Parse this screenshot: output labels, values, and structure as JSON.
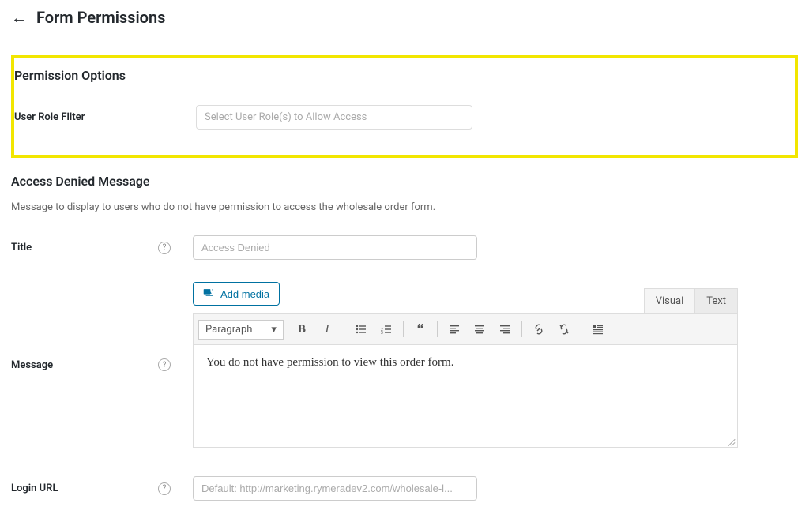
{
  "header": {
    "back_icon": "←",
    "title": "Form Permissions"
  },
  "permission_options": {
    "section_title": "Permission Options",
    "user_role_filter": {
      "label": "User Role Filter",
      "placeholder": "Select User Role(s) to Allow Access"
    }
  },
  "access_denied": {
    "section_title": "Access Denied Message",
    "description": "Message to display to users who do not have permission to access the wholesale order form.",
    "title": {
      "label": "Title",
      "placeholder": "Access Denied"
    },
    "message": {
      "label": "Message",
      "add_media_label": "Add media",
      "format_label": "Paragraph",
      "tabs": {
        "visual": "Visual",
        "text": "Text"
      },
      "content": "You do not have permission to view this order form."
    },
    "login_url": {
      "label": "Login URL",
      "placeholder": "Default: http://marketing.rymeradev2.com/wholesale-l..."
    }
  },
  "toolbar_icons": {
    "bold": "B",
    "italic": "I",
    "quote": "❝",
    "dropdown_caret": "▾"
  }
}
